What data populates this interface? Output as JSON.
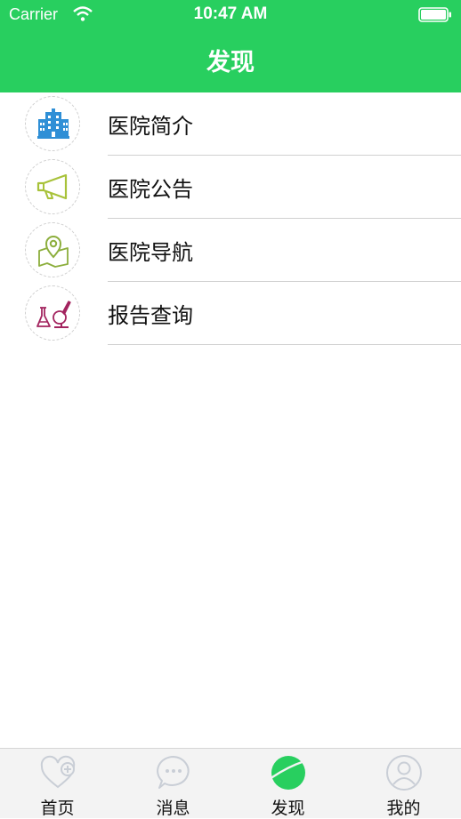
{
  "status_bar": {
    "carrier": "Carrier",
    "time": "10:47 AM"
  },
  "nav": {
    "title": "发现"
  },
  "list": [
    {
      "label": "医院简介",
      "icon": "hospital-building-icon"
    },
    {
      "label": "医院公告",
      "icon": "megaphone-icon"
    },
    {
      "label": "医院导航",
      "icon": "map-pin-icon"
    },
    {
      "label": "报告查询",
      "icon": "lab-flask-microscope-icon"
    }
  ],
  "tabbar": [
    {
      "label": "首页",
      "icon": "heart-plus-icon",
      "active": false
    },
    {
      "label": "消息",
      "icon": "chat-bubble-icon",
      "active": false
    },
    {
      "label": "发现",
      "icon": "planet-icon",
      "active": true
    },
    {
      "label": "我的",
      "icon": "user-icon",
      "active": false
    }
  ],
  "colors": {
    "accent": "#28cf5f",
    "hospital_icon": "#2f8fd6",
    "notice_icon": "#a8c23a",
    "nav_icon": "#8cae3c",
    "report_icon": "#a3245f",
    "tab_inactive": "#c9ced6"
  }
}
